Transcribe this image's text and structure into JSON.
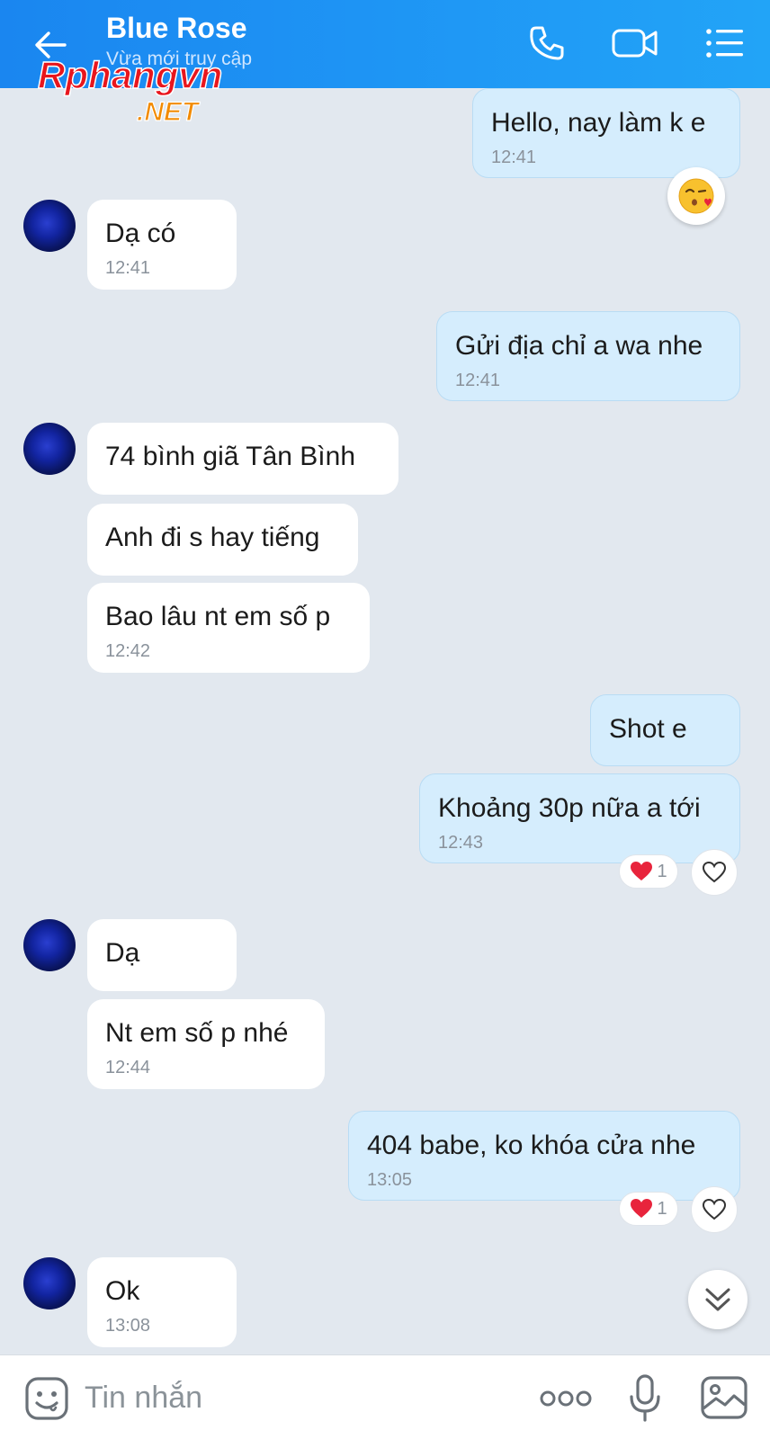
{
  "header": {
    "contact_name": "Blue Rose",
    "status": "Vừa mới truy cập",
    "icons": [
      "back-arrow-icon",
      "phone-icon",
      "video-call-icon",
      "menu-list-icon"
    ]
  },
  "watermark": {
    "line1": "Rphangvn",
    "line2": ".NET"
  },
  "messages": [
    {
      "dir": "out",
      "text": "Hello, nay làm k e",
      "time": "12:41",
      "reaction_emoji": "kiss-face-icon"
    },
    {
      "dir": "in",
      "text": "Dạ có",
      "time": "12:41"
    },
    {
      "dir": "out",
      "text": "Gửi địa chỉ a wa nhe",
      "time": "12:41"
    },
    {
      "dir": "in",
      "text": "74 bình giã Tân Bình"
    },
    {
      "dir": "in",
      "text": "Anh đi s hay tiếng"
    },
    {
      "dir": "in",
      "text": "Bao lâu nt em số p",
      "time": "12:42"
    },
    {
      "dir": "out",
      "text": "Shot e"
    },
    {
      "dir": "out",
      "text": "Khoảng 30p nữa a tới",
      "time": "12:43",
      "reaction_count": "1"
    },
    {
      "dir": "in",
      "text": "Dạ"
    },
    {
      "dir": "in",
      "text": "Nt em số p nhé",
      "time": "12:44"
    },
    {
      "dir": "out",
      "text": "404 babe, ko khóa cửa nhe",
      "time": "13:05",
      "reaction_count": "1"
    },
    {
      "dir": "in",
      "text": "Ok",
      "time": "13:08"
    }
  ],
  "composer": {
    "placeholder": "Tin nhắn",
    "icons": [
      "sticker-icon",
      "more-icon",
      "microphone-icon",
      "image-icon"
    ]
  },
  "colors": {
    "header_start": "#1a86f0",
    "header_end": "#22a4f7",
    "chat_bg": "#e2e8ef",
    "outgoing_bubble": "#d5edfd",
    "incoming_bubble": "#ffffff",
    "heart": "#e8243c"
  }
}
